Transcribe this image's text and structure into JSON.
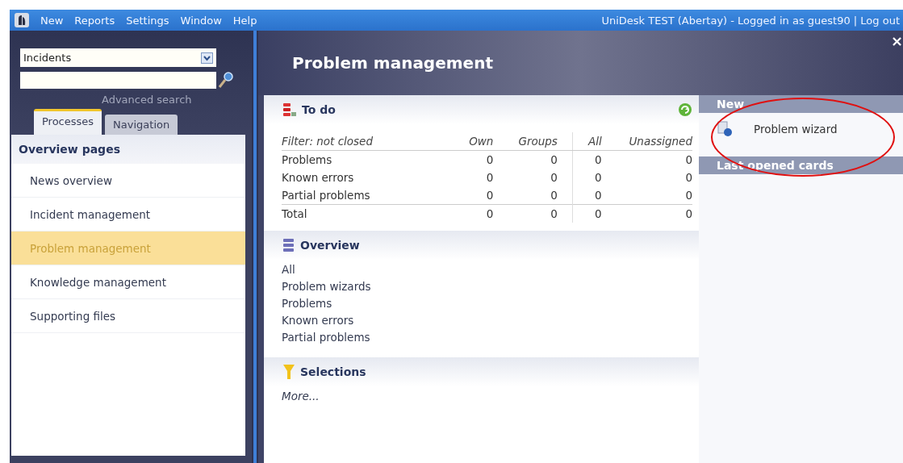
{
  "menu_bar": {
    "items": [
      "New",
      "Reports",
      "Settings",
      "Window",
      "Help"
    ],
    "status": "UniDesk TEST (Abertay) - Logged in as guest90 | Log out"
  },
  "sidebar": {
    "dropdown": {
      "value": "Incidents"
    },
    "advanced_search": "Advanced search",
    "tabs": [
      {
        "label": "Processes",
        "selected": true
      },
      {
        "label": "Navigation",
        "selected": false
      }
    ],
    "section_title": "Overview pages",
    "items": [
      {
        "label": "News overview",
        "selected": false
      },
      {
        "label": "Incident management",
        "selected": false
      },
      {
        "label": "Problem management",
        "selected": true
      },
      {
        "label": "Knowledge management",
        "selected": false
      },
      {
        "label": "Supporting files",
        "selected": false
      }
    ]
  },
  "page_title": "Problem management",
  "todo": {
    "title": "To do",
    "filter": "Filter: not closed",
    "columns": [
      "Own",
      "Groups",
      "All",
      "Unassigned"
    ],
    "rows": [
      {
        "label": "Problems",
        "values": [
          "0",
          "0",
          "0",
          "0"
        ]
      },
      {
        "label": "Known errors",
        "values": [
          "0",
          "0",
          "0",
          "0"
        ]
      },
      {
        "label": "Partial problems",
        "values": [
          "0",
          "0",
          "0",
          "0"
        ]
      },
      {
        "label": "Total",
        "values": [
          "0",
          "0",
          "0",
          "0"
        ]
      }
    ]
  },
  "overview": {
    "title": "Overview",
    "links": [
      "All",
      "Problem wizards",
      "Problems",
      "Known errors",
      "Partial problems"
    ]
  },
  "selections": {
    "title": "Selections",
    "more": "More..."
  },
  "right_panel": {
    "new_title": "New",
    "new_items": [
      "Problem wizard"
    ],
    "last_title": "Last opened cards",
    "close": "×"
  }
}
